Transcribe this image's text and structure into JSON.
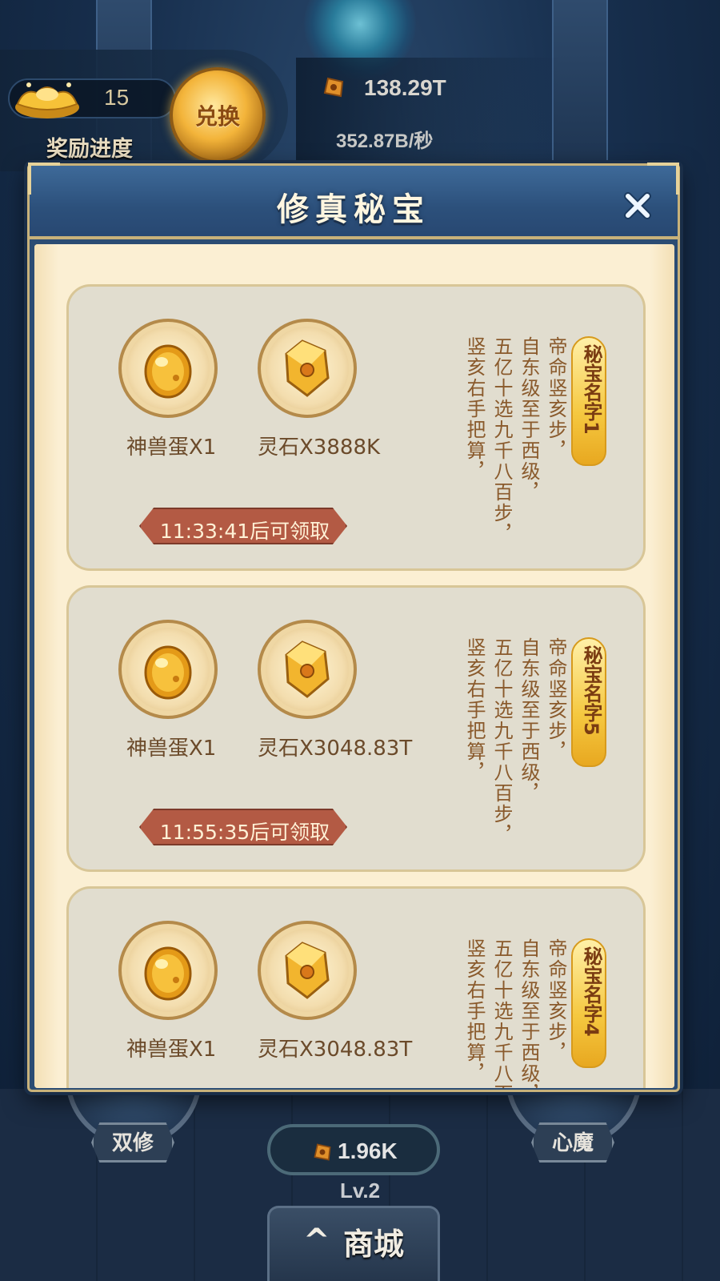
{
  "hud": {
    "reward_count": "15",
    "reward_label": "奖励进度",
    "exchange_label": "兑换",
    "stone_total": "138.29T",
    "stone_rate": "352.87B/秒"
  },
  "modal": {
    "title": "修真秘宝",
    "close_icon": "close-icon"
  },
  "cards": [
    {
      "name": "秘宝名字1",
      "items": [
        {
          "icon": "beast-egg-icon",
          "label": "神兽蛋X1"
        },
        {
          "icon": "spirit-stone-icon",
          "label": "灵石X3888K"
        }
      ],
      "timer": "11:33:41后可领取",
      "description": [
        "帝命竖亥步，",
        "自东级至于西级，",
        "五亿十选九千八百步，",
        "竖亥右手把算，"
      ]
    },
    {
      "name": "秘宝名字5",
      "items": [
        {
          "icon": "beast-egg-icon",
          "label": "神兽蛋X1"
        },
        {
          "icon": "spirit-stone-icon",
          "label": "灵石X3048.83T"
        }
      ],
      "timer": "11:55:35后可领取",
      "description": [
        "帝命竖亥步，",
        "自东级至于西级，",
        "五亿十选九千八百步，",
        "竖亥右手把算，"
      ]
    },
    {
      "name": "秘宝名字4",
      "items": [
        {
          "icon": "beast-egg-icon",
          "label": "神兽蛋X1"
        },
        {
          "icon": "spirit-stone-icon",
          "label": "灵石X3048.83T"
        }
      ],
      "timer": "",
      "description": [
        "帝命竖亥步，",
        "自东级至于西级，",
        "五亿十选九千八百步，",
        "竖亥右手把算，"
      ]
    }
  ],
  "bottom": {
    "dual_cultivation": "双修",
    "inner_demon": "心魔",
    "center_currency": "1.96K",
    "level": "Lv.2",
    "shop": "商城"
  },
  "colors": {
    "modal_frame": "#2b4c73",
    "modal_body": "#fbefd3",
    "card_bg": "#e1ddcf",
    "timer_banner": "#b35a44",
    "name_tag": "#f5c840",
    "description_text": "#8a5a2c"
  }
}
